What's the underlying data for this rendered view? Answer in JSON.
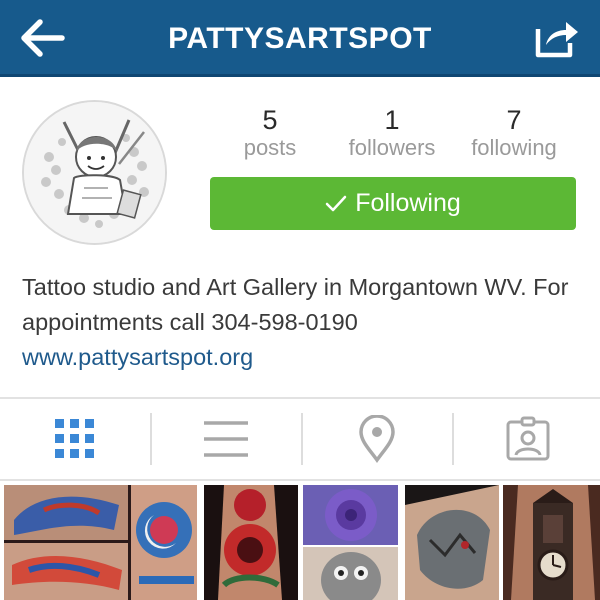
{
  "header": {
    "title": "PATTYSARTSPOT",
    "back_icon": "arrow-left-icon",
    "share_icon": "share-icon",
    "background": "#175a8c"
  },
  "profile": {
    "stats": {
      "posts": {
        "count": "5",
        "label": "posts"
      },
      "followers": {
        "count": "1",
        "label": "followers"
      },
      "following": {
        "count": "7",
        "label": "following"
      }
    },
    "follow_button": {
      "label": "Following",
      "icon": "checkmark-icon",
      "color": "#5cb835"
    },
    "bio": "Tattoo studio and Art Gallery in Morgantown WV. For appointments call 304-598-0190",
    "website": "www.pattysartspot.org",
    "link_color": "#1f5a8c"
  },
  "tabs": [
    {
      "name": "grid-view",
      "icon": "grid-icon",
      "active": true
    },
    {
      "name": "list-view",
      "icon": "list-icon",
      "active": false
    },
    {
      "name": "map-view",
      "icon": "location-pin-icon",
      "active": false
    },
    {
      "name": "tagged",
      "icon": "tagged-photo-icon",
      "active": false
    }
  ],
  "colors": {
    "active_tab": "#3b88d6",
    "inactive_tab": "#a8a8a8"
  }
}
